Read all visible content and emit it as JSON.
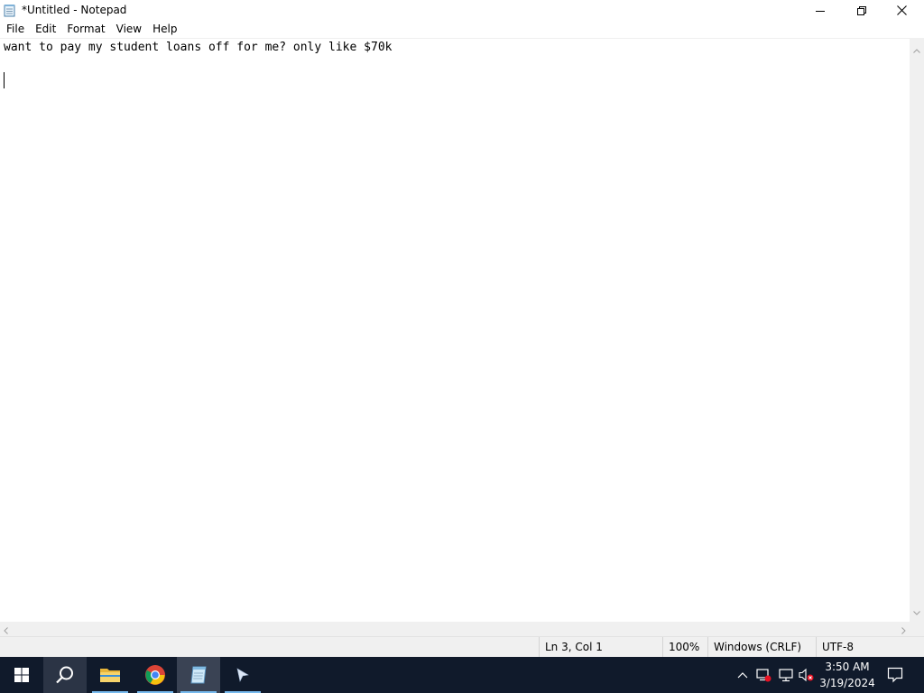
{
  "window": {
    "title": "*Untitled - Notepad"
  },
  "menu": {
    "items": [
      "File",
      "Edit",
      "Format",
      "View",
      "Help"
    ]
  },
  "editor": {
    "lines": [
      "want to pay my student loans off for me? only like $70k",
      "",
      ""
    ]
  },
  "status": {
    "position": "Ln 3, Col 1",
    "zoom": "100%",
    "line_ending": "Windows (CRLF)",
    "encoding": "UTF-8"
  },
  "taskbar": {
    "apps": [
      "start",
      "search",
      "file-explorer",
      "chrome",
      "notepad",
      "terminal"
    ],
    "active_app": "notepad",
    "clock": {
      "time": "3:50 AM",
      "date": "3/19/2024"
    }
  },
  "colors": {
    "taskbar_bg": "#101a2b",
    "accent": "#76b9ed",
    "statusbar_bg": "#f0f0f0"
  }
}
